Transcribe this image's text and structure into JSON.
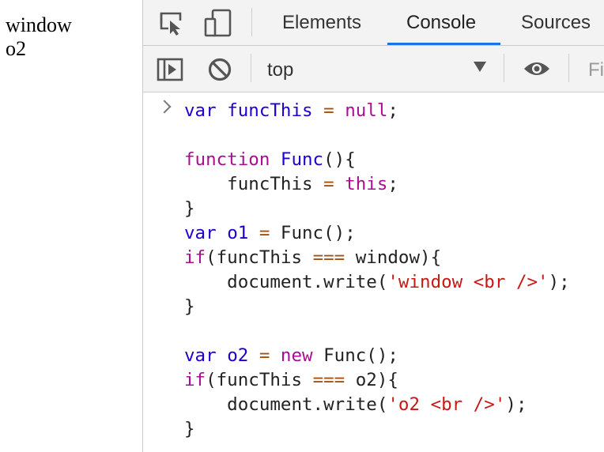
{
  "page": {
    "lines": [
      "window",
      "o2"
    ]
  },
  "devtools": {
    "tabs": [
      "Elements",
      "Console",
      "Sources"
    ],
    "active_tab": "Console",
    "toolbar": {
      "context": "top",
      "filter_placeholder": "Fi"
    },
    "console": {
      "code": [
        [
          [
            "kwv",
            "var"
          ],
          [
            "txt",
            " "
          ],
          [
            "var",
            "funcThis"
          ],
          [
            "txt",
            " "
          ],
          [
            "op",
            "="
          ],
          [
            "txt",
            " "
          ],
          [
            "kw",
            "null"
          ],
          [
            "txt",
            ";"
          ]
        ],
        [],
        [
          [
            "kw",
            "function"
          ],
          [
            "txt",
            " "
          ],
          [
            "fn",
            "Func"
          ],
          [
            "txt",
            "(){"
          ]
        ],
        [
          [
            "txt",
            "    funcThis "
          ],
          [
            "op",
            "="
          ],
          [
            "txt",
            " "
          ],
          [
            "kw",
            "this"
          ],
          [
            "txt",
            ";"
          ]
        ],
        [
          [
            "txt",
            "}"
          ]
        ],
        [
          [
            "kwv",
            "var"
          ],
          [
            "txt",
            " "
          ],
          [
            "var",
            "o1"
          ],
          [
            "txt",
            " "
          ],
          [
            "op",
            "="
          ],
          [
            "txt",
            " Func();"
          ]
        ],
        [
          [
            "kw",
            "if"
          ],
          [
            "txt",
            "(funcThis "
          ],
          [
            "op",
            "==="
          ],
          [
            "txt",
            " window){"
          ]
        ],
        [
          [
            "txt",
            "    document.write("
          ],
          [
            "str",
            "'window <br />'"
          ],
          [
            "txt",
            ");"
          ]
        ],
        [
          [
            "txt",
            "}"
          ]
        ],
        [],
        [
          [
            "kwv",
            "var"
          ],
          [
            "txt",
            " "
          ],
          [
            "var",
            "o2"
          ],
          [
            "txt",
            " "
          ],
          [
            "op",
            "="
          ],
          [
            "txt",
            " "
          ],
          [
            "kw",
            "new"
          ],
          [
            "txt",
            " Func();"
          ]
        ],
        [
          [
            "kw",
            "if"
          ],
          [
            "txt",
            "(funcThis "
          ],
          [
            "op",
            "==="
          ],
          [
            "txt",
            " o2){"
          ]
        ],
        [
          [
            "txt",
            "    document.write("
          ],
          [
            "str",
            "'o2 <br />'"
          ],
          [
            "txt",
            ");"
          ]
        ],
        [
          [
            "txt",
            "}"
          ]
        ]
      ]
    }
  },
  "colors": {
    "accent": "#1a73e8",
    "keyword": "#aa0d91",
    "variable": "#1c00cf",
    "operator": "#a6500e",
    "string": "#c41a16"
  },
  "icons": [
    "inspect-element-icon",
    "device-toolbar-icon",
    "sidebar-toggle-icon",
    "clear-console-icon",
    "dropdown-arrow-icon",
    "eye-icon",
    "prompt-chevron-icon"
  ]
}
